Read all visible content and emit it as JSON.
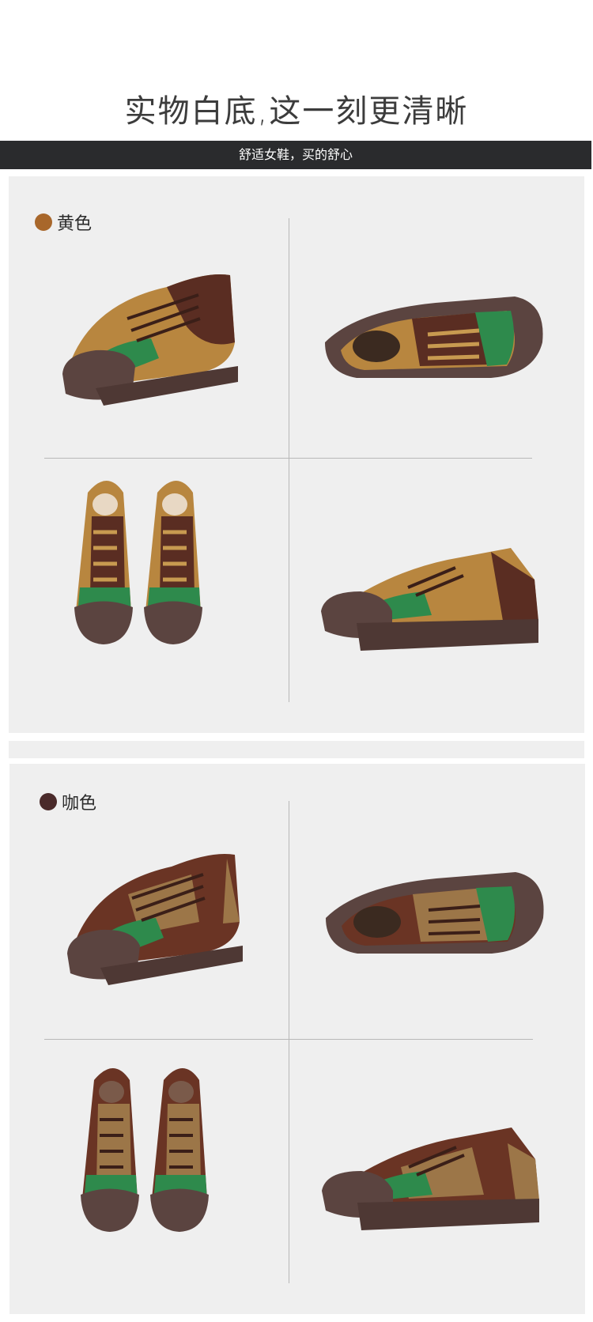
{
  "header": {
    "title": "实物白底,这一刻更清晰",
    "subtitle": "舒适女鞋，买的舒心"
  },
  "sections": [
    {
      "label": "黄色",
      "dot_color": "#a8672b",
      "upper": "#b8863f",
      "dark": "#5a2d22",
      "accent": "#2e8a4c",
      "sole": "#5b4440",
      "views": [
        "three-quarter-shoe-icon",
        "outsole-side-shoe-icon",
        "top-pair-shoe-icon",
        "side-shoe-icon"
      ]
    },
    {
      "label": "咖色",
      "dot_color": "#4a2a2a",
      "upper": "#6a3424",
      "dark": "#4b2219",
      "accent": "#2e8a4c",
      "sole": "#5b4440",
      "views": [
        "three-quarter-shoe-icon",
        "outsole-side-shoe-icon",
        "top-pair-shoe-icon",
        "side-shoe-icon"
      ]
    }
  ]
}
